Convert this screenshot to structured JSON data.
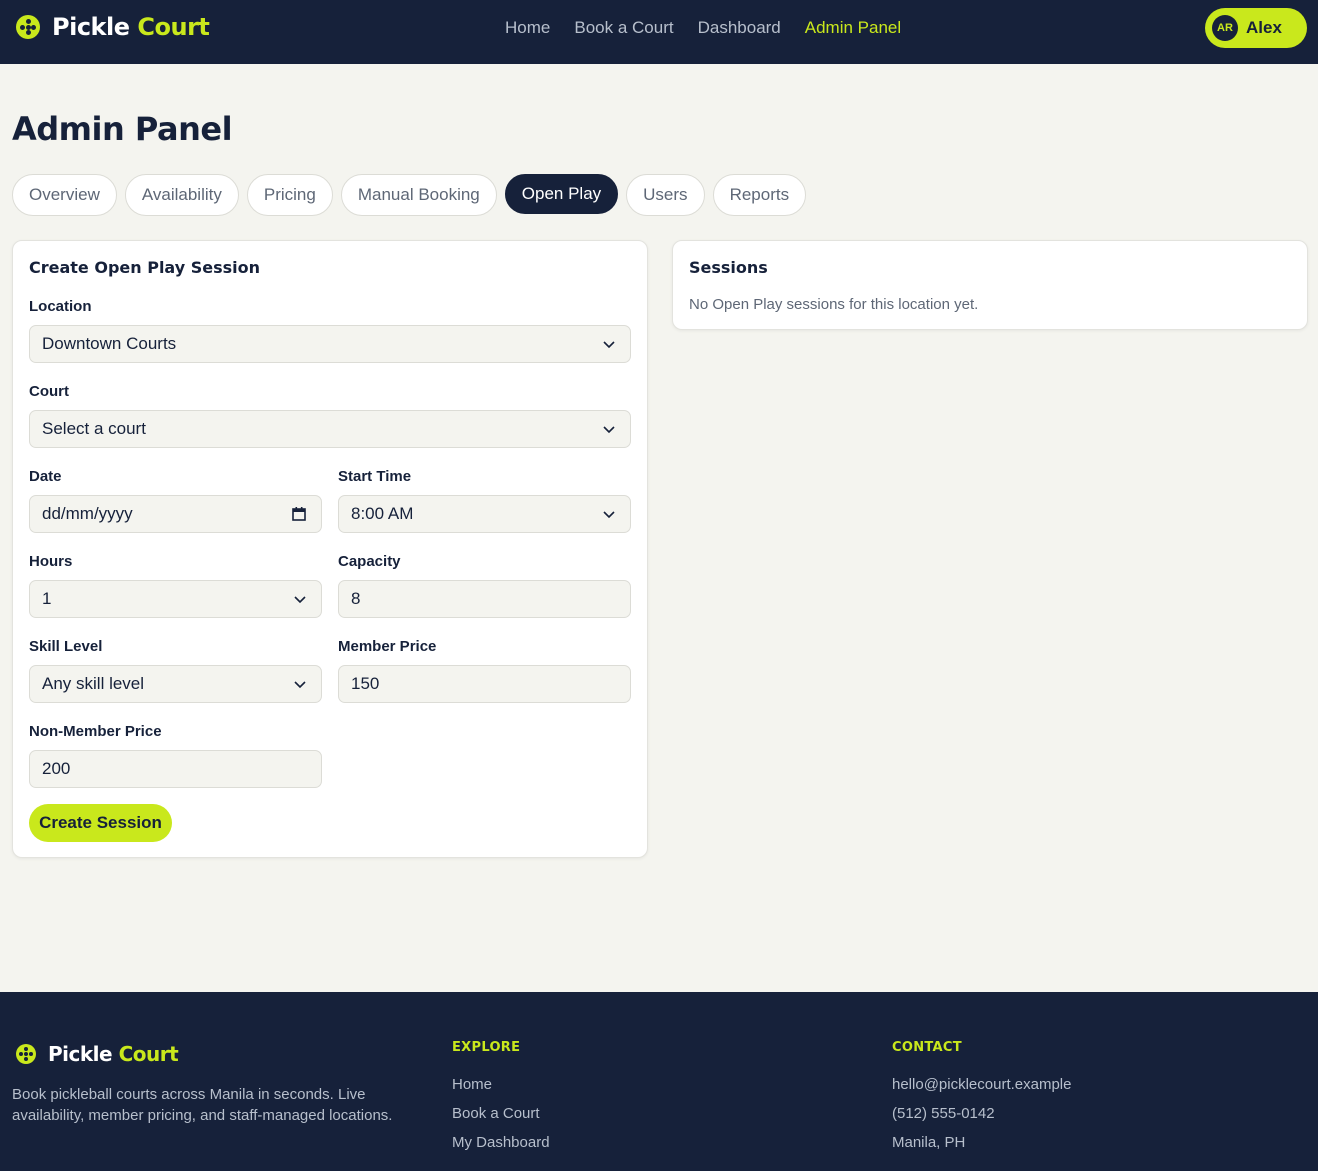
{
  "brand": {
    "word1": "Pickle",
    "word2": "Court",
    "logo_icon": "pickleball-icon"
  },
  "nav": {
    "items": [
      "Home",
      "Book a Court",
      "Dashboard",
      "Admin Panel"
    ],
    "active": "Admin Panel"
  },
  "user": {
    "initials": "AR",
    "name": "Alex"
  },
  "page": {
    "title": "Admin Panel"
  },
  "tabs": [
    "Overview",
    "Availability",
    "Pricing",
    "Manual Booking",
    "Open Play",
    "Users",
    "Reports"
  ],
  "active_tab": "Open Play",
  "create_form": {
    "title": "Create Open Play Session",
    "location": {
      "label": "Location",
      "value": "Downtown Courts"
    },
    "court": {
      "label": "Court",
      "value": "Select a court"
    },
    "date": {
      "label": "Date",
      "value": "dd/mm/yyyy"
    },
    "start_time": {
      "label": "Start Time",
      "value": "8:00 AM"
    },
    "hours": {
      "label": "Hours",
      "value": "1"
    },
    "capacity": {
      "label": "Capacity",
      "value": "8"
    },
    "skill_level": {
      "label": "Skill Level",
      "value": "Any skill level"
    },
    "member_price": {
      "label": "Member Price",
      "value": "150"
    },
    "non_member_price": {
      "label": "Non-Member Price",
      "value": "200"
    },
    "submit_label": "Create Session"
  },
  "sessions": {
    "title": "Sessions",
    "empty_text": "No Open Play sessions for this location yet."
  },
  "footer": {
    "description": "Book pickleball courts across Manila in seconds. Live availability, member pricing, and staff-managed locations.",
    "explore": {
      "heading": "EXPLORE",
      "links": [
        "Home",
        "Book a Court",
        "My Dashboard"
      ]
    },
    "contact": {
      "heading": "CONTACT",
      "email": "hello@picklecourt.example",
      "phone": "(512) 555-0142",
      "location": "Manila, PH"
    }
  },
  "colors": {
    "navy": "#16213a",
    "accent": "#c9e81c",
    "background": "#f4f4ef"
  }
}
